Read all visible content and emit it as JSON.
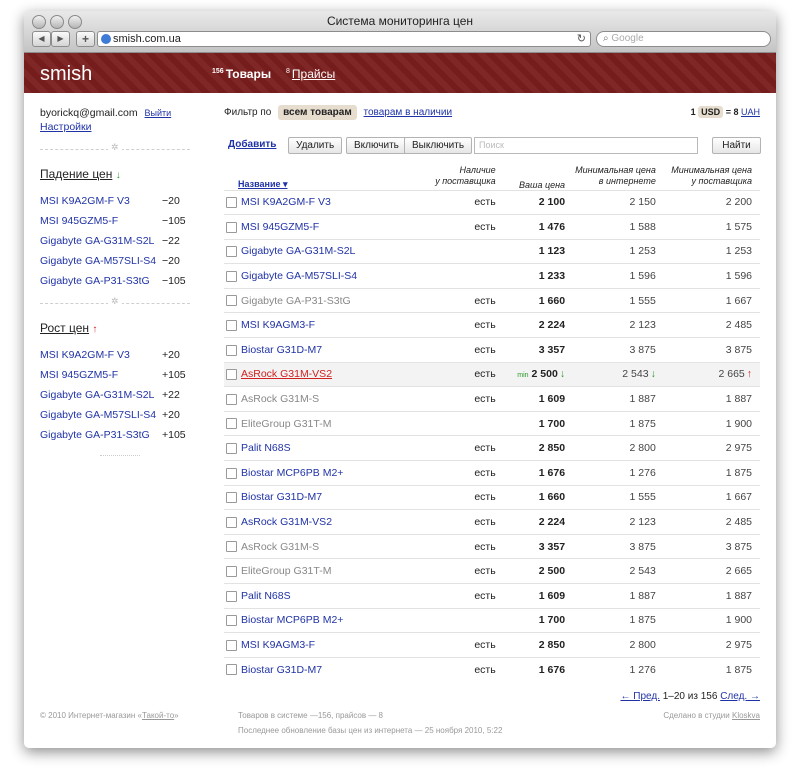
{
  "browser": {
    "title": "Система мониторинга цен",
    "url": "smish.com.ua",
    "search_placeholder": "Google"
  },
  "header": {
    "logo": "smish",
    "nav": [
      {
        "count": "156",
        "label": "Товары"
      },
      {
        "count": "8",
        "label": "Прайсы"
      }
    ]
  },
  "user": {
    "email": "byorickq@gmail.com",
    "logout": "Выйти",
    "settings": "Настройки"
  },
  "sidebar": {
    "drop": {
      "title": "Падение цен",
      "arrow": "↓",
      "items": [
        {
          "name": "MSI K9A2GM-F V3",
          "delta": "−20"
        },
        {
          "name": "MSI 945GZM5-F",
          "delta": "−105"
        },
        {
          "name": "Gigabyte GA-G31M-S2L",
          "delta": "−22"
        },
        {
          "name": "Gigabyte GA-M57SLI-S4",
          "delta": "−20"
        },
        {
          "name": "Gigabyte GA-P31-S3tG",
          "delta": "−105"
        }
      ]
    },
    "rise": {
      "title": "Рост цен",
      "arrow": "↑",
      "items": [
        {
          "name": "MSI K9A2GM-F V3",
          "delta": "+20"
        },
        {
          "name": "MSI 945GZM5-F",
          "delta": "+105"
        },
        {
          "name": "Gigabyte GA-G31M-S2L",
          "delta": "+22"
        },
        {
          "name": "Gigabyte GA-M57SLI-S4",
          "delta": "+20"
        },
        {
          "name": "Gigabyte GA-P31-S3tG",
          "delta": "+105"
        }
      ]
    }
  },
  "filter": {
    "label": "Фильтр по",
    "active": "всем товарам",
    "other": "товарам в наличии",
    "currency_prefix": "1",
    "currency": "USD",
    "rate": "= 8",
    "target_currency": "UAH"
  },
  "toolbar": {
    "add": "Добавить",
    "delete": "Удалить",
    "enable": "Включить",
    "disable": "Выключить",
    "search_placeholder": "Поиск",
    "find": "Найти"
  },
  "columns": {
    "name": "Название ▾",
    "stock_1": "Наличие",
    "stock_2": "у поставщика",
    "price": "Ваша цена",
    "min_internet_1": "Минимальная цена",
    "min_internet_2": "в интернете",
    "min_supplier_1": "Минимальная цена",
    "min_supplier_2": "у поставщика"
  },
  "rows": [
    {
      "name": "MSI K9A2GM-F V3",
      "stock": "есть",
      "price": "2 100",
      "min_internet": "2 150",
      "min_supplier": "2 200",
      "disabled": false
    },
    {
      "name": "MSI 945GZM5-F",
      "stock": "есть",
      "price": "1 476",
      "min_internet": "1 588",
      "min_supplier": "1 575",
      "disabled": false
    },
    {
      "name": "Gigabyte GA-G31M-S2L",
      "stock": "",
      "price": "1 123",
      "min_internet": "1 253",
      "min_supplier": "1 253",
      "disabled": false
    },
    {
      "name": "Gigabyte GA-M57SLI-S4",
      "stock": "",
      "price": "1 233",
      "min_internet": "1 596",
      "min_supplier": "1 596",
      "disabled": false
    },
    {
      "name": "Gigabyte GA-P31-S3tG",
      "stock": "есть",
      "price": "1 660",
      "min_internet": "1 555",
      "min_supplier": "1 667",
      "disabled": true
    },
    {
      "name": "MSI K9AGM3-F",
      "stock": "есть",
      "price": "2 224",
      "min_internet": "2 123",
      "min_supplier": "2 485",
      "disabled": false
    },
    {
      "name": "Biostar G31D-M7",
      "stock": "есть",
      "price": "3 357",
      "min_internet": "3 875",
      "min_supplier": "3 875",
      "disabled": false
    },
    {
      "name": "AsRock G31M-VS2",
      "stock": "есть",
      "price": "2 500",
      "min_internet": "2 543",
      "min_supplier": "2 665",
      "disabled": true,
      "hover": true,
      "price_tag": "min",
      "price_arrow": "↓",
      "internet_arrow": "↓",
      "supplier_arrow": "↑"
    },
    {
      "name": "AsRock G31M-S",
      "stock": "есть",
      "price": "1 609",
      "min_internet": "1 887",
      "min_supplier": "1 887",
      "disabled": true
    },
    {
      "name": "EliteGroup G31T-M",
      "stock": "",
      "price": "1 700",
      "min_internet": "1 875",
      "min_supplier": "1 900",
      "disabled": true
    },
    {
      "name": "Palit N68S",
      "stock": "есть",
      "price": "2 850",
      "min_internet": "2 800",
      "min_supplier": "2 975",
      "disabled": false
    },
    {
      "name": "Biostar MCP6PB M2+",
      "stock": "есть",
      "price": "1 676",
      "min_internet": "1 276",
      "min_supplier": "1 875",
      "disabled": false
    },
    {
      "name": "Biostar G31D-M7",
      "stock": "есть",
      "price": "1 660",
      "min_internet": "1 555",
      "min_supplier": "1 667",
      "disabled": false
    },
    {
      "name": "AsRock G31M-VS2",
      "stock": "есть",
      "price": "2 224",
      "min_internet": "2 123",
      "min_supplier": "2 485",
      "disabled": false
    },
    {
      "name": "AsRock G31M-S",
      "stock": "есть",
      "price": "3 357",
      "min_internet": "3 875",
      "min_supplier": "3 875",
      "disabled": true
    },
    {
      "name": "EliteGroup G31T-M",
      "stock": "есть",
      "price": "2 500",
      "min_internet": "2 543",
      "min_supplier": "2 665",
      "disabled": true
    },
    {
      "name": "Palit N68S",
      "stock": "есть",
      "price": "1 609",
      "min_internet": "1 887",
      "min_supplier": "1 887",
      "disabled": false
    },
    {
      "name": "Biostar MCP6PB M2+",
      "stock": "",
      "price": "1 700",
      "min_internet": "1 875",
      "min_supplier": "1 900",
      "disabled": false
    },
    {
      "name": "MSI K9AGM3-F",
      "stock": "есть",
      "price": "2 850",
      "min_internet": "2 800",
      "min_supplier": "2 975",
      "disabled": false
    },
    {
      "name": "Biostar G31D-M7",
      "stock": "есть",
      "price": "1 676",
      "min_internet": "1 276",
      "min_supplier": "1 875",
      "disabled": false
    }
  ],
  "pagination": {
    "prev": "← Пред.",
    "range": "1–20 из 156",
    "next": "След. →"
  },
  "footer": {
    "copyright": "© 2010 Интернет-магазин «",
    "shop_name": "Такой-то",
    "copyright_end": "»",
    "stats": "Товаров в системе —156, прайсов — 8",
    "updated": "Последнее обновление базы цен из интернета — 25 ноября 2010, 5:22",
    "made_by": "Сделано в студии",
    "studio": "Kloskva"
  },
  "colors": {
    "header_bg": "#7a1e1e",
    "link": "#2033a6",
    "drop_arrow": "#2a9a2a",
    "rise_arrow": "#d02020",
    "hover_link": "#d02020"
  }
}
